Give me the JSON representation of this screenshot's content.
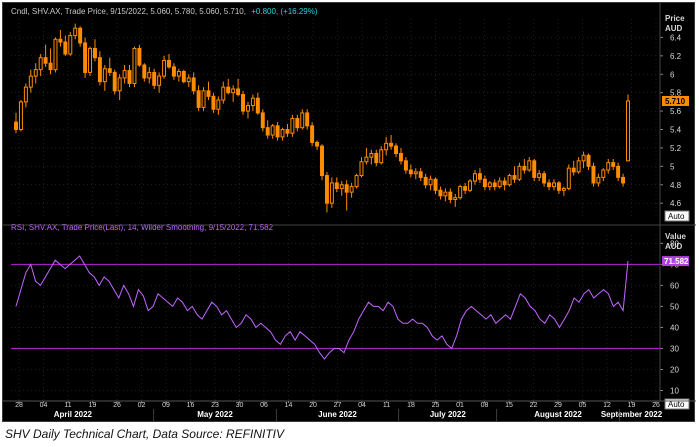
{
  "chart_data": {
    "type": "candlestick",
    "upper_panel": {
      "legend": {
        "prefix": "Cndl, SHV.AX, Trade Price, 9/15/2022, 5.060, 5.780, 5.060, 5.710,",
        "change": "+0.800, (+16.29%)"
      },
      "axis_title_line1": "Price",
      "axis_title_line2": "AUD",
      "ylim": [
        4.45,
        6.6
      ],
      "yticks": [
        4.6,
        4.8,
        5.0,
        5.2,
        5.4,
        5.6,
        5.8,
        6.0,
        6.2,
        6.4
      ],
      "ytick_labels": [
        "4.6",
        "4.8",
        "5",
        "5.2",
        "5.4",
        "5.6",
        "5.8",
        "6",
        "6.2",
        "6.4"
      ],
      "last_value_label": "5.710",
      "auto_label": "Auto",
      "candles_ohlc": [
        [
          5.48,
          5.58,
          5.36,
          5.4
        ],
        [
          5.4,
          5.72,
          5.38,
          5.7
        ],
        [
          5.7,
          5.9,
          5.64,
          5.86
        ],
        [
          5.86,
          6.05,
          5.8,
          5.98
        ],
        [
          5.98,
          6.12,
          5.9,
          6.05
        ],
        [
          6.05,
          6.22,
          5.98,
          6.18
        ],
        [
          6.18,
          6.32,
          6.08,
          6.12
        ],
        [
          6.12,
          6.28,
          6.0,
          6.05
        ],
        [
          6.05,
          6.4,
          6.02,
          6.38
        ],
        [
          6.38,
          6.48,
          6.3,
          6.35
        ],
        [
          6.35,
          6.42,
          6.2,
          6.22
        ],
        [
          6.22,
          6.46,
          6.2,
          6.42
        ],
        [
          6.42,
          6.55,
          6.38,
          6.5
        ],
        [
          6.5,
          6.52,
          6.3,
          6.34
        ],
        [
          6.34,
          6.4,
          5.96,
          6.02
        ],
        [
          6.02,
          6.3,
          5.98,
          6.28
        ],
        [
          6.28,
          6.38,
          6.14,
          6.18
        ],
        [
          6.18,
          6.25,
          5.88,
          5.92
        ],
        [
          5.92,
          6.1,
          5.82,
          6.06
        ],
        [
          6.06,
          6.18,
          5.98,
          6.02
        ],
        [
          6.02,
          6.05,
          5.78,
          5.82
        ],
        [
          5.82,
          6.0,
          5.72,
          5.96
        ],
        [
          5.96,
          6.1,
          5.9,
          6.04
        ],
        [
          6.04,
          6.1,
          5.86,
          5.9
        ],
        [
          5.9,
          6.3,
          5.86,
          6.28
        ],
        [
          6.28,
          6.32,
          6.08,
          6.1
        ],
        [
          6.1,
          6.12,
          5.92,
          5.96
        ],
        [
          5.96,
          6.08,
          5.9,
          6.02
        ],
        [
          6.02,
          6.06,
          5.84,
          5.88
        ],
        [
          5.88,
          6.02,
          5.8,
          5.98
        ],
        [
          5.98,
          6.2,
          5.95,
          6.15
        ],
        [
          6.15,
          6.22,
          6.06,
          6.08
        ],
        [
          6.08,
          6.12,
          5.94,
          5.98
        ],
        [
          5.98,
          6.06,
          5.92,
          6.03
        ],
        [
          6.03,
          6.05,
          5.9,
          5.92
        ],
        [
          5.92,
          6.0,
          5.86,
          5.96
        ],
        [
          5.96,
          6.02,
          5.78,
          5.82
        ],
        [
          5.82,
          5.88,
          5.6,
          5.64
        ],
        [
          5.64,
          5.86,
          5.6,
          5.82
        ],
        [
          5.82,
          5.92,
          5.72,
          5.76
        ],
        [
          5.76,
          5.8,
          5.58,
          5.62
        ],
        [
          5.62,
          5.76,
          5.56,
          5.72
        ],
        [
          5.72,
          5.92,
          5.68,
          5.86
        ],
        [
          5.86,
          5.95,
          5.78,
          5.8
        ],
        [
          5.8,
          5.88,
          5.7,
          5.84
        ],
        [
          5.84,
          5.95,
          5.76,
          5.78
        ],
        [
          5.78,
          5.82,
          5.56,
          5.6
        ],
        [
          5.6,
          5.7,
          5.52,
          5.66
        ],
        [
          5.66,
          5.78,
          5.6,
          5.74
        ],
        [
          5.74,
          5.8,
          5.56,
          5.58
        ],
        [
          5.58,
          5.62,
          5.38,
          5.42
        ],
        [
          5.42,
          5.5,
          5.3,
          5.34
        ],
        [
          5.34,
          5.46,
          5.3,
          5.44
        ],
        [
          5.44,
          5.48,
          5.28,
          5.32
        ],
        [
          5.32,
          5.42,
          5.28,
          5.4
        ],
        [
          5.4,
          5.46,
          5.32,
          5.36
        ],
        [
          5.36,
          5.56,
          5.32,
          5.52
        ],
        [
          5.52,
          5.56,
          5.38,
          5.42
        ],
        [
          5.42,
          5.62,
          5.4,
          5.58
        ],
        [
          5.58,
          5.62,
          5.4,
          5.44
        ],
        [
          5.44,
          5.48,
          5.22,
          5.26
        ],
        [
          5.26,
          5.28,
          5.18,
          5.22
        ],
        [
          5.22,
          5.24,
          4.85,
          4.9
        ],
        [
          4.9,
          4.94,
          4.5,
          4.6
        ],
        [
          4.6,
          4.88,
          4.55,
          4.82
        ],
        [
          4.82,
          4.88,
          4.72,
          4.76
        ],
        [
          4.76,
          4.84,
          4.68,
          4.8
        ],
        [
          4.8,
          4.85,
          4.52,
          4.72
        ],
        [
          4.72,
          4.82,
          4.66,
          4.78
        ],
        [
          4.78,
          4.92,
          4.76,
          4.9
        ],
        [
          4.9,
          5.1,
          4.88,
          5.05
        ],
        [
          5.05,
          5.2,
          5.02,
          5.1
        ],
        [
          5.1,
          5.18,
          5.02,
          5.14
        ],
        [
          5.14,
          5.18,
          5.0,
          5.04
        ],
        [
          5.04,
          5.22,
          5.02,
          5.18
        ],
        [
          5.18,
          5.32,
          5.12,
          5.25
        ],
        [
          5.25,
          5.34,
          5.18,
          5.22
        ],
        [
          5.22,
          5.25,
          5.1,
          5.14
        ],
        [
          5.14,
          5.2,
          5.02,
          5.06
        ],
        [
          5.06,
          5.1,
          4.92,
          4.96
        ],
        [
          4.96,
          5.02,
          4.88,
          4.92
        ],
        [
          4.92,
          4.98,
          4.86,
          4.94
        ],
        [
          4.94,
          4.98,
          4.84,
          4.88
        ],
        [
          4.88,
          4.92,
          4.76,
          4.8
        ],
        [
          4.8,
          4.9,
          4.74,
          4.86
        ],
        [
          4.86,
          4.88,
          4.7,
          4.74
        ],
        [
          4.74,
          4.78,
          4.64,
          4.68
        ],
        [
          4.68,
          4.76,
          4.62,
          4.72
        ],
        [
          4.72,
          4.76,
          4.6,
          4.64
        ],
        [
          4.64,
          4.7,
          4.56,
          4.66
        ],
        [
          4.66,
          4.8,
          4.64,
          4.78
        ],
        [
          4.78,
          4.82,
          4.7,
          4.74
        ],
        [
          4.74,
          4.86,
          4.72,
          4.84
        ],
        [
          4.84,
          4.96,
          4.8,
          4.92
        ],
        [
          4.92,
          4.98,
          4.82,
          4.86
        ],
        [
          4.86,
          4.9,
          4.74,
          4.78
        ],
        [
          4.78,
          4.84,
          4.74,
          4.82
        ],
        [
          4.82,
          4.86,
          4.74,
          4.78
        ],
        [
          4.78,
          4.88,
          4.76,
          4.84
        ],
        [
          4.84,
          4.88,
          4.74,
          4.8
        ],
        [
          4.8,
          4.92,
          4.78,
          4.9
        ],
        [
          4.9,
          5.0,
          4.82,
          4.86
        ],
        [
          4.86,
          5.04,
          4.84,
          5.0
        ],
        [
          5.0,
          5.08,
          4.92,
          4.96
        ],
        [
          4.96,
          5.1,
          4.94,
          5.06
        ],
        [
          5.06,
          5.08,
          4.84,
          4.88
        ],
        [
          4.88,
          4.96,
          4.84,
          4.92
        ],
        [
          4.92,
          4.95,
          4.78,
          4.82
        ],
        [
          4.82,
          4.86,
          4.74,
          4.78
        ],
        [
          4.78,
          4.86,
          4.74,
          4.82
        ],
        [
          4.82,
          4.84,
          4.7,
          4.74
        ],
        [
          4.74,
          4.78,
          4.68,
          4.76
        ],
        [
          4.76,
          5.02,
          4.74,
          4.98
        ],
        [
          4.98,
          5.06,
          4.9,
          4.94
        ],
        [
          4.94,
          5.1,
          4.92,
          5.06
        ],
        [
          5.06,
          5.16,
          4.98,
          5.12
        ],
        [
          5.12,
          5.14,
          4.96,
          5.0
        ],
        [
          5.0,
          5.04,
          4.78,
          4.82
        ],
        [
          4.82,
          4.92,
          4.78,
          4.88
        ],
        [
          4.88,
          4.98,
          4.84,
          4.96
        ],
        [
          4.96,
          5.08,
          4.92,
          5.04
        ],
        [
          5.04,
          5.08,
          4.96,
          5.0
        ],
        [
          5.0,
          5.04,
          4.84,
          4.88
        ],
        [
          4.88,
          4.92,
          4.78,
          4.82
        ],
        [
          5.06,
          5.78,
          5.06,
          5.71
        ]
      ]
    },
    "lower_panel": {
      "legend": "RSI, SHV.AX, Trade Price(Last), 14, Wilder Smoothing, 9/15/2022, 71.582",
      "axis_title_line1": "Value",
      "axis_title_line2": "AUD",
      "ylim": [
        5,
        84
      ],
      "yticks": [
        10,
        20,
        30,
        40,
        50,
        60,
        70,
        80
      ],
      "ytick_labels": [
        "10",
        "20",
        "30",
        "40",
        "50",
        "60",
        "70",
        "80"
      ],
      "overbought_level": 70,
      "oversold_level": 30,
      "last_value_label": "71.582",
      "auto_label": "Auto",
      "rsi_values": [
        50,
        58,
        66,
        70,
        62,
        60,
        64,
        68,
        72,
        70,
        68,
        70,
        72,
        74,
        70,
        66,
        64,
        60,
        64,
        62,
        58,
        54,
        60,
        56,
        50,
        58,
        55,
        48,
        50,
        56,
        54,
        52,
        50,
        54,
        52,
        48,
        50,
        46,
        44,
        48,
        52,
        50,
        46,
        48,
        44,
        40,
        42,
        46,
        44,
        40,
        42,
        40,
        38,
        34,
        32,
        36,
        38,
        34,
        38,
        36,
        34,
        32,
        28,
        25,
        28,
        30,
        30,
        28,
        34,
        38,
        44,
        48,
        52,
        50,
        50,
        48,
        52,
        50,
        44,
        42,
        42,
        44,
        42,
        42,
        40,
        36,
        34,
        36,
        32,
        30,
        36,
        44,
        48,
        50,
        48,
        46,
        44,
        46,
        42,
        44,
        46,
        44,
        50,
        56,
        54,
        50,
        48,
        44,
        42,
        46,
        44,
        40,
        44,
        48,
        54,
        52,
        56,
        58,
        54,
        56,
        58,
        56,
        50,
        52,
        48,
        71.582
      ]
    },
    "x_axis": {
      "day_ticks": [
        "28",
        "04",
        "11",
        "19",
        "26",
        "02",
        "09",
        "16",
        "23",
        "30",
        "06",
        "14",
        "20",
        "27",
        "04",
        "11",
        "18",
        "25",
        "01",
        "08",
        "15",
        "22",
        "29",
        "05",
        "12",
        "19",
        "26"
      ],
      "month_labels": [
        "April 2022",
        "May 2022",
        "June 2022",
        "July 2022",
        "August 2022",
        "September 2022"
      ]
    },
    "colors": {
      "background": "#000000",
      "candle": "#ff8c00",
      "rsi_line": "#c266ff",
      "band_line": "#a020c0",
      "grid": "#3a3a3a",
      "tick_text": "#d8d8d8",
      "legend_prefix": "#c9c9c9",
      "legend_change": "#2ad3e0",
      "rsi_legend": "#c266ff"
    }
  },
  "caption": "SHV Daily Technical Chart, Data Source: REFINITIV"
}
